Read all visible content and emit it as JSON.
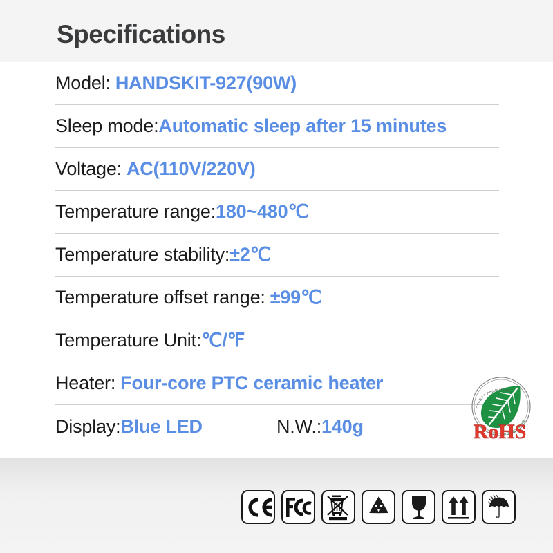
{
  "header": {
    "title": "Specifications"
  },
  "specs": {
    "rows": [
      {
        "label": "Model:",
        "value": "HANDSKIT-927(90W)",
        "gap": true
      },
      {
        "label": "Sleep mode:",
        "value": "Automatic sleep after 15 minutes",
        "gap": false
      },
      {
        "label": "Voltage:",
        "value": "AC(110V/220V)",
        "gap": true
      },
      {
        "label": "Temperature range:",
        "value": "180~480℃",
        "gap": false
      },
      {
        "label": "Temperature stability:",
        "value": "±2℃",
        "gap": false
      },
      {
        "label": "Temperature offset range:",
        "value": "±99℃",
        "gap": true
      },
      {
        "label": "Temperature Unit:",
        "value": "℃/℉",
        "gap": false
      },
      {
        "label": "Heater:",
        "value": "Four-core PTC ceramic heater",
        "gap": true
      }
    ],
    "final_row": {
      "label_a": "Display:",
      "value_a": "Blue LED",
      "label_b": "N.W.:",
      "value_b": "140g"
    }
  },
  "rohs": {
    "wordmark": "RoHS",
    "ring_text_top": "Act-BAT Popltech Inc.",
    "ring_text_bottom": "Green Product",
    "leaf_color": "#1e9142",
    "wordmark_color": "#e03a2f"
  },
  "certifications": {
    "icons": [
      {
        "name": "ce-mark-icon",
        "label": "CE"
      },
      {
        "name": "fcc-mark-icon",
        "label": "FC"
      },
      {
        "name": "weee-bin-icon",
        "label": "WEEE"
      },
      {
        "name": "recycle-icon",
        "label": "Recycle"
      },
      {
        "name": "fragile-glass-icon",
        "label": "Fragile"
      },
      {
        "name": "this-side-up-icon",
        "label": "This Side Up"
      },
      {
        "name": "keep-dry-icon",
        "label": "Keep Dry"
      }
    ]
  },
  "colors": {
    "value_blue": "#5a8ee4",
    "label_black": "#1b1b1b",
    "title_gray": "#3a3b3d",
    "header_bg": "#f4f4f5",
    "divider": "#cfcfcf"
  }
}
